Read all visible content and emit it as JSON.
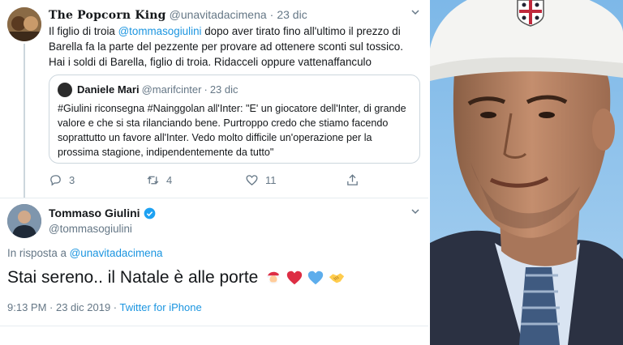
{
  "tweet1": {
    "display_name": "The Popcorn King",
    "handle": "@unavitadacimena",
    "separator": "·",
    "date": "23 dic",
    "text_before_mention": "Il figlio di troia ",
    "mention": "@tommasogiulini",
    "text_after_mention": " dopo aver tirato fino all'ultimo il prezzo di Barella fa la parte del pezzente per provare ad ottenere sconti sul tossico. Hai i soldi di Barella, figlio di troia. Ridacceli oppure vattenaffanculo",
    "quote": {
      "display_name": "Daniele Mari",
      "handle": "@marifcinter",
      "separator": "·",
      "date": "23 dic",
      "text": "#Giulini riconsegna #Nainggolan all'Inter: \"E' un giocatore dell'Inter, di grande valore e che si sta rilanciando bene. Purtroppo credo che stiamo facendo soprattutto un favore all'Inter. Vedo molto difficile un'operazione per la prossima stagione, indipendentemente da tutto\""
    },
    "actions": {
      "replies": "3",
      "retweets": "4",
      "likes": "11"
    }
  },
  "tweet2": {
    "display_name": "Tommaso Giulini",
    "handle": "@tommasogiulini",
    "reply_prefix": "In risposta a ",
    "reply_to": "@unavitadacimena",
    "text": "Stai sereno.. il Natale è alle porte",
    "emojis": [
      "santa-emoji",
      "red-heart-emoji",
      "blue-heart-emoji",
      "handshake-emoji"
    ],
    "time": "9:13 PM · 23 dic 2019 · ",
    "source": "Twitter for iPhone"
  },
  "colors": {
    "link": "#1b95e0",
    "muted": "#657786",
    "verified": "#1da1f2",
    "heart": "#e0245e"
  }
}
